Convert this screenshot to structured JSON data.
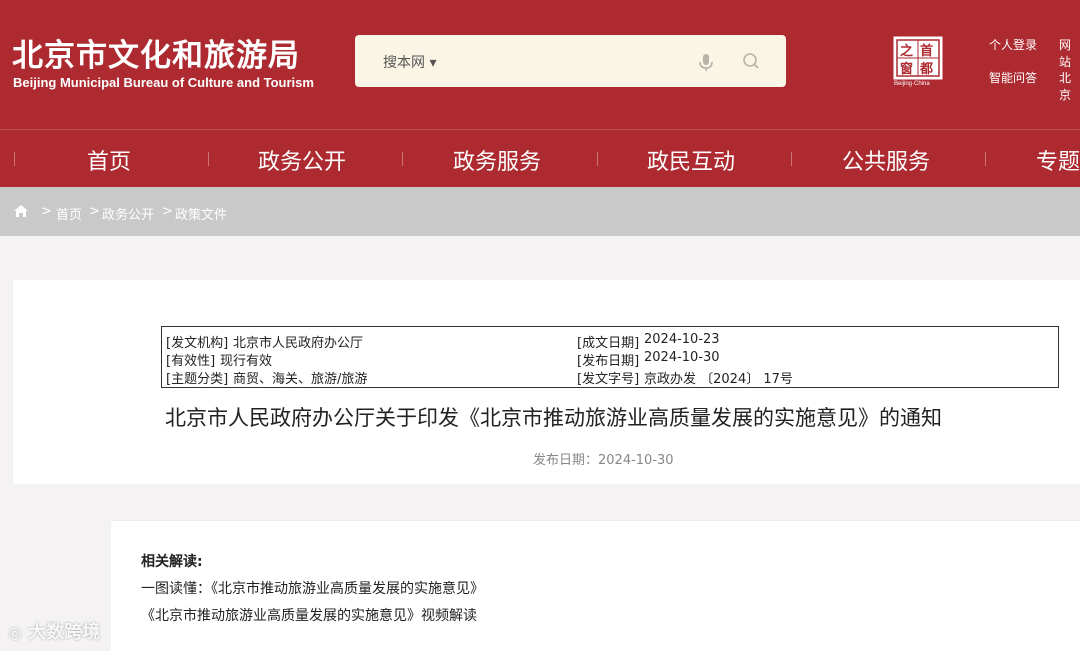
{
  "header": {
    "logo_cn": "北京市文化和旅游局",
    "logo_en": "Beijing Municipal Bureau of Culture and Tourism",
    "search_scope": "搜本网 ▾",
    "seal_chars": [
      "首",
      "之",
      "都",
      "窗"
    ],
    "seal_caption": "Beijing·China",
    "links": [
      "个人登录",
      "网站",
      "智能问答",
      "北京"
    ]
  },
  "nav": {
    "items": [
      "首页",
      "政务公开",
      "政务服务",
      "政民互动",
      "公共服务",
      "专题"
    ]
  },
  "breadcrumb": {
    "items": [
      "首页",
      "政务公开",
      "政策文件"
    ],
    "separator": ">"
  },
  "meta": {
    "issuer_label": "[发文机构]",
    "issuer": "北京市人民政府办公厅",
    "validity_label": "[有效性]",
    "validity": "现行有效",
    "topic_label": "[主题分类]",
    "topic": "商贸、海关、旅游/旅游",
    "written_label": "[成文日期]",
    "written": "2024-10-23",
    "published_label": "[发布日期]",
    "published": "2024-10-30",
    "docno_label": "[发文字号]",
    "docno": "京政办发 〔2024〕 17号"
  },
  "article": {
    "title": "北京市人民政府办公厅关于印发《北京市推动旅游业高质量发展的实施意见》的通知",
    "pubdate": "发布日期：2024-10-30"
  },
  "related": {
    "heading": "相关解读:",
    "links": [
      "一图读懂：《北京市推动旅游业高质量发展的实施意见》",
      "《北京市推动旅游业高质量发展的实施意见》视频解读"
    ]
  },
  "watermark": "大数跨境",
  "colors": {
    "brand_red": "#ae2a31",
    "crumb_gray": "#c9c9c9",
    "search_bg": "#fbf5e6"
  }
}
